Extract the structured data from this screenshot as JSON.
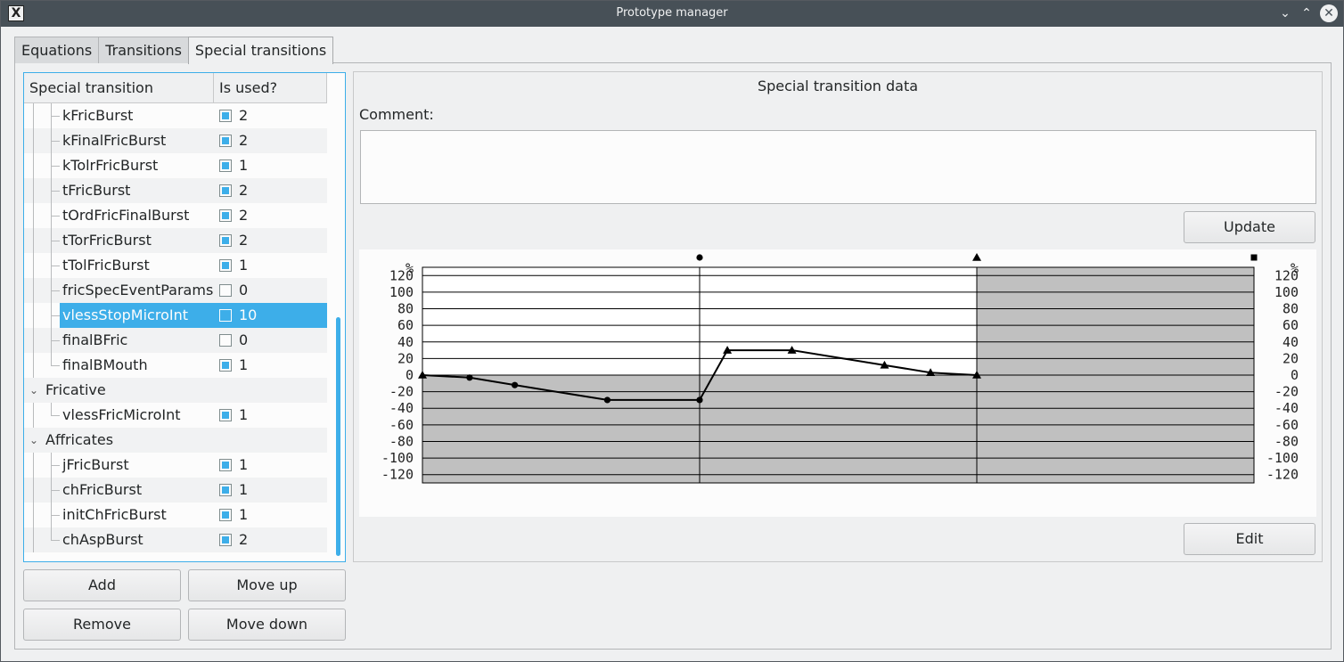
{
  "window": {
    "title": "Prototype manager",
    "app_icon": "X"
  },
  "tabs": [
    {
      "label": "Equations"
    },
    {
      "label": "Transitions"
    },
    {
      "label": "Special transitions",
      "active": true
    }
  ],
  "tree": {
    "headers": {
      "name": "Special transition",
      "used": "Is used?"
    },
    "rows": [
      {
        "name": "kFricBurst",
        "checked": true,
        "count": "2"
      },
      {
        "name": "kFinalFricBurst",
        "checked": true,
        "count": "2"
      },
      {
        "name": "kTolrFricBurst",
        "checked": true,
        "count": "1"
      },
      {
        "name": "tFricBurst",
        "checked": true,
        "count": "2"
      },
      {
        "name": "tOrdFricFinalBurst",
        "checked": true,
        "count": "2"
      },
      {
        "name": "tTorFricBurst",
        "checked": true,
        "count": "2"
      },
      {
        "name": "tTolFricBurst",
        "checked": true,
        "count": "1"
      },
      {
        "name": "fricSpecEventParams",
        "checked": false,
        "count": "0"
      },
      {
        "name": "vlessStopMicroInt",
        "checked": false,
        "count": "10",
        "selected": true
      },
      {
        "name": "finalBFric",
        "checked": false,
        "count": "0"
      },
      {
        "name": "finalBMouth",
        "checked": true,
        "count": "1",
        "last": true
      },
      {
        "name": "Fricative",
        "group": true
      },
      {
        "name": "vlessFricMicroInt",
        "checked": true,
        "count": "1",
        "last": true
      },
      {
        "name": "Affricates",
        "group": true
      },
      {
        "name": "jFricBurst",
        "checked": true,
        "count": "1"
      },
      {
        "name": "chFricBurst",
        "checked": true,
        "count": "1"
      },
      {
        "name": "initChFricBurst",
        "checked": true,
        "count": "1"
      },
      {
        "name": "chAspBurst",
        "checked": true,
        "count": "2",
        "last": true
      }
    ]
  },
  "buttons": {
    "add": "Add",
    "move_up": "Move up",
    "remove": "Remove",
    "move_down": "Move down",
    "update": "Update",
    "edit": "Edit"
  },
  "panel": {
    "title": "Special transition data",
    "comment_label": "Comment:",
    "comment_value": ""
  },
  "chart_data": {
    "type": "line",
    "ylabel_left": "%",
    "ylabel_right": "%",
    "ylim": [
      -130,
      130
    ],
    "xlim": [
      0,
      3
    ],
    "yticks": [
      120,
      100,
      80,
      60,
      40,
      20,
      0,
      -20,
      -40,
      -60,
      -80,
      -100,
      -120
    ],
    "grid": true,
    "segment_markers": [
      {
        "at": 1,
        "shape": "circle"
      },
      {
        "at": 2,
        "shape": "triangle"
      },
      {
        "at": 3,
        "shape": "square"
      }
    ],
    "inactive_region": [
      2,
      3
    ],
    "points": [
      {
        "x": 0.0,
        "y": 0,
        "marker": "triangle"
      },
      {
        "x": 0.17,
        "y": -3,
        "marker": "circle"
      },
      {
        "x": 0.333,
        "y": -12,
        "marker": "circle"
      },
      {
        "x": 0.667,
        "y": -30,
        "marker": "circle"
      },
      {
        "x": 1.0,
        "y": -30,
        "marker": "circle"
      },
      {
        "x": 1.1,
        "y": 30,
        "marker": "triangle"
      },
      {
        "x": 1.333,
        "y": 30,
        "marker": "triangle"
      },
      {
        "x": 1.667,
        "y": 12,
        "marker": "triangle"
      },
      {
        "x": 1.833,
        "y": 3,
        "marker": "triangle"
      },
      {
        "x": 2.0,
        "y": 0,
        "marker": "triangle"
      }
    ]
  }
}
